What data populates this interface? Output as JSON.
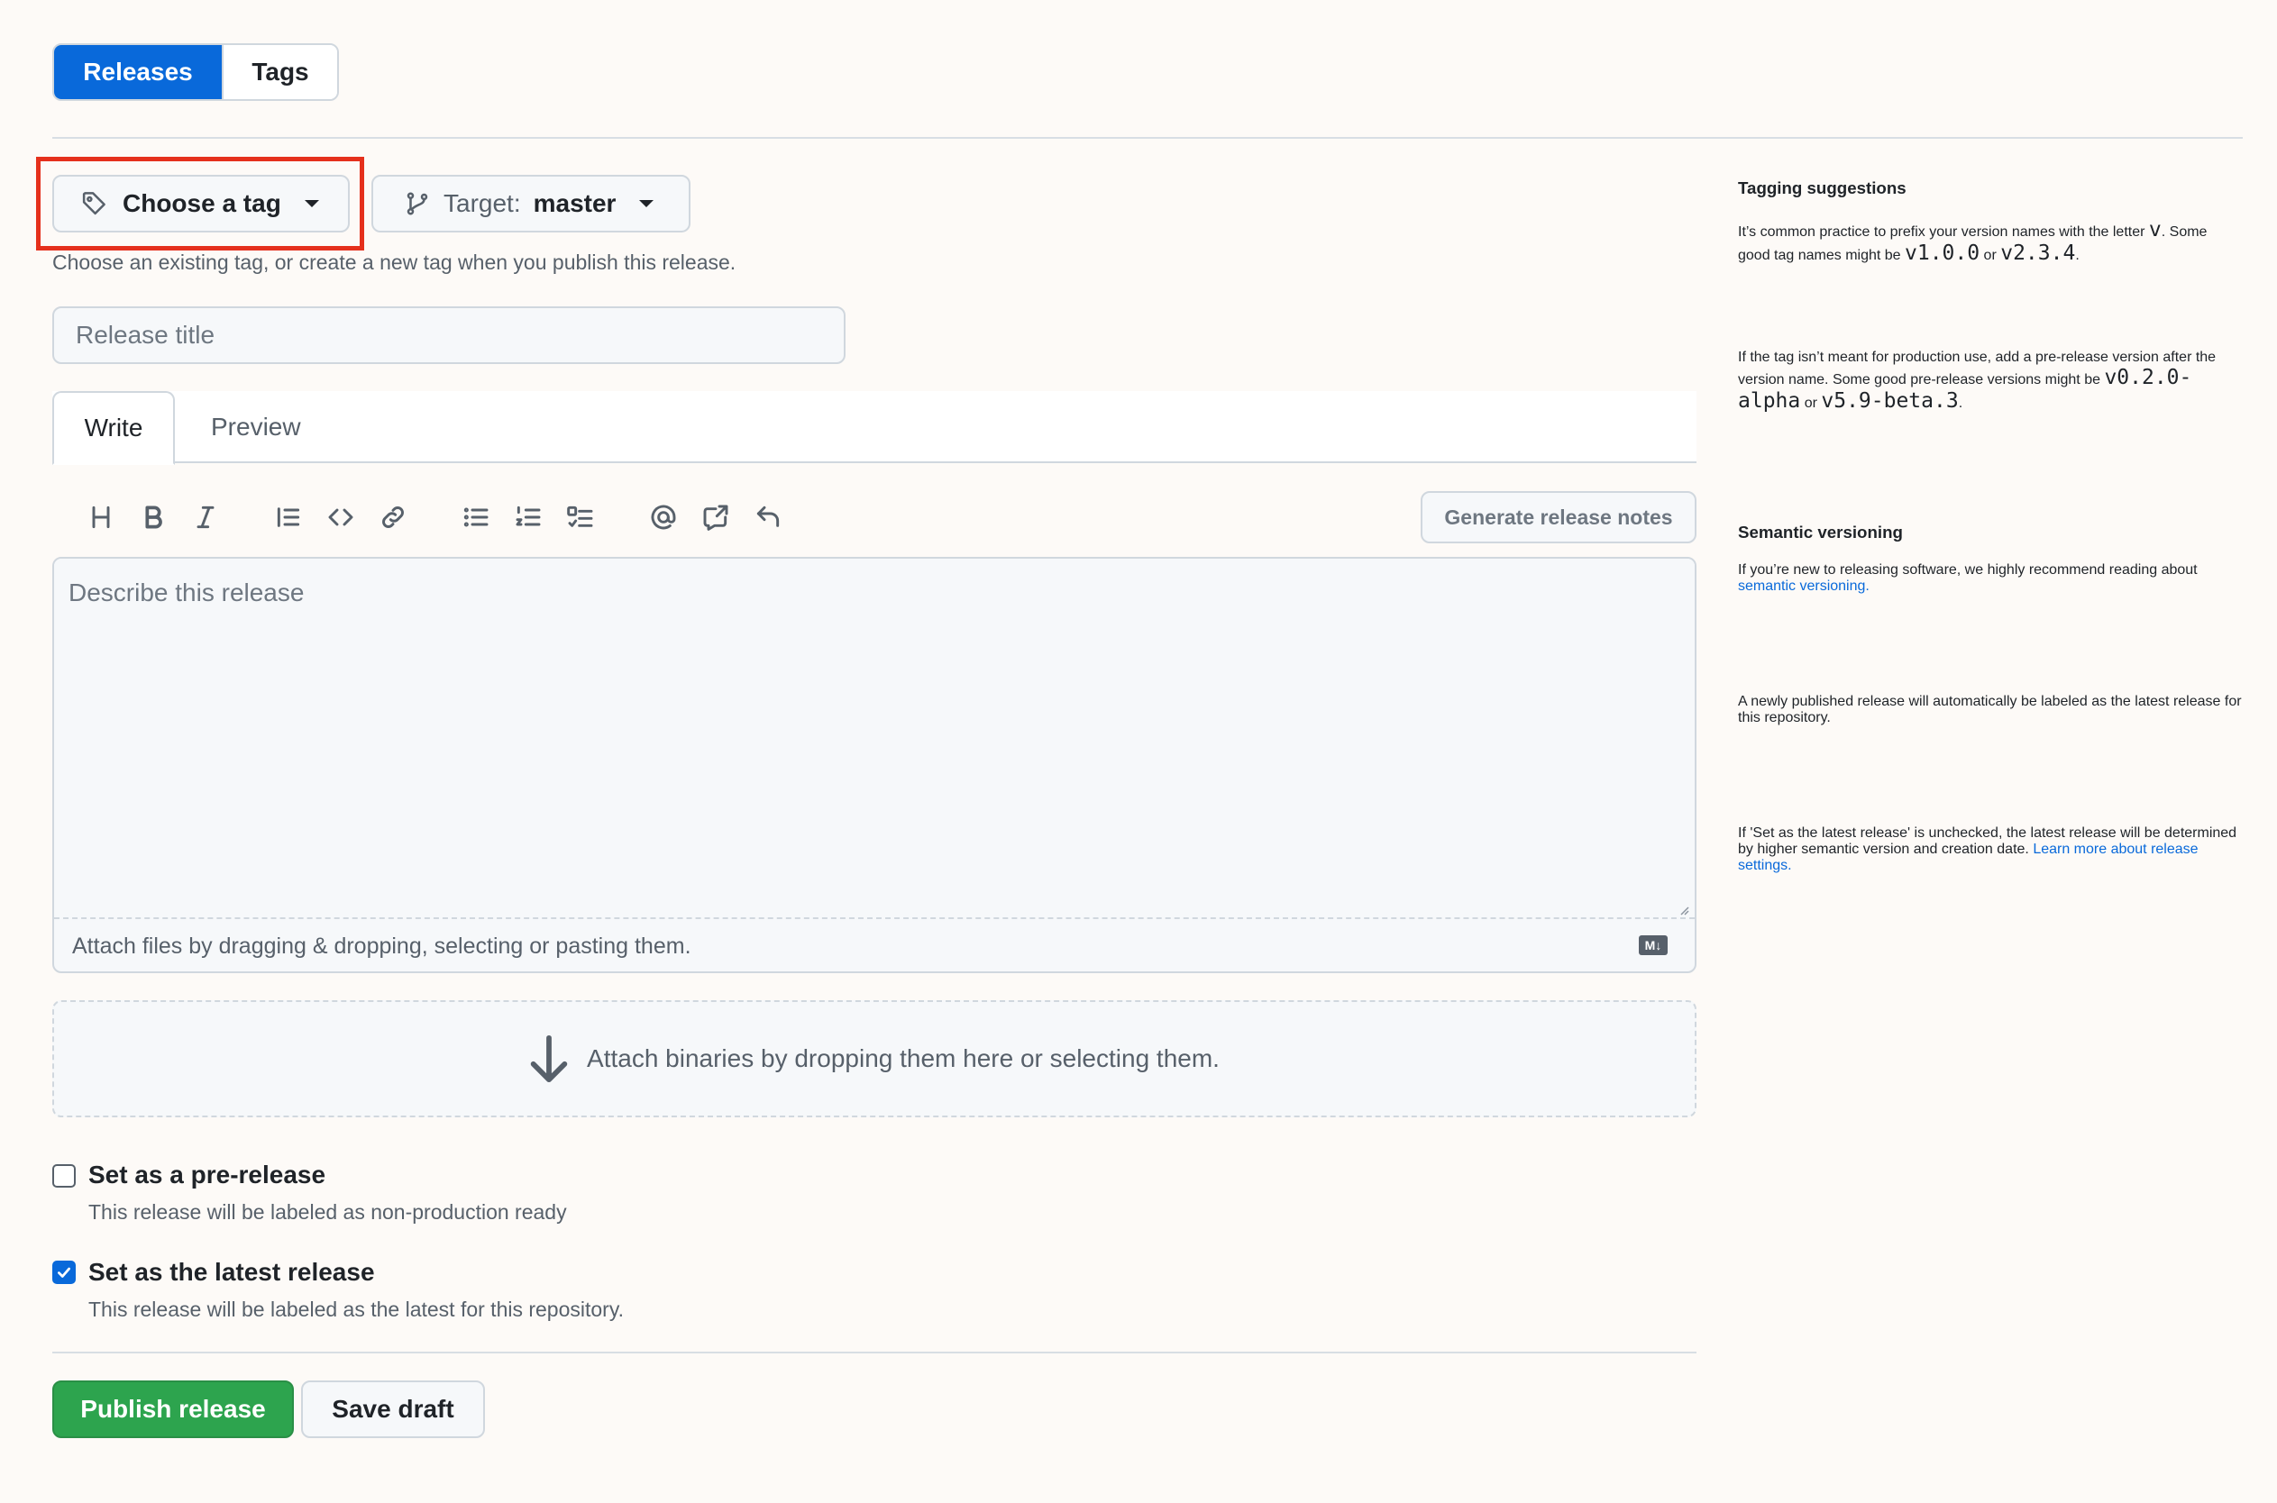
{
  "tabs": {
    "releases": "Releases",
    "tags": "Tags"
  },
  "tag_picker": {
    "label": "Choose a tag"
  },
  "target_picker": {
    "prefix": "Target:",
    "branch": "master"
  },
  "tag_hint": "Choose an existing tag, or create a new tag when you publish this release.",
  "release_title": {
    "placeholder": "Release title",
    "value": ""
  },
  "editor": {
    "tab_write": "Write",
    "tab_preview": "Preview",
    "generate_notes": "Generate release notes",
    "placeholder": "Describe this release",
    "attach_hint": "Attach files by dragging & dropping, selecting or pasting them.",
    "markdown_badge": "M↓",
    "toolbar": [
      "heading-icon",
      "bold-icon",
      "italic-icon",
      "quote-icon",
      "code-icon",
      "link-icon",
      "bulleted-list-icon",
      "numbered-list-icon",
      "task-list-icon",
      "mention-icon",
      "cross-reference-icon",
      "reply-icon"
    ]
  },
  "binaries_drop": "Attach binaries by dropping them here or selecting them.",
  "prerelease": {
    "label": "Set as a pre-release",
    "desc": "This release will be labeled as non-production ready",
    "checked": false
  },
  "latest": {
    "label": "Set as the latest release",
    "desc": "This release will be labeled as the latest for this repository.",
    "checked": true
  },
  "actions": {
    "publish": "Publish release",
    "draft": "Save draft"
  },
  "sidebar": {
    "tagging_title": "Tagging suggestions",
    "tagging_p1_a": "It’s common practice to prefix your version names with the letter ",
    "tagging_p1_code_v": "v",
    "tagging_p1_b": ". Some good tag names might be ",
    "tagging_p1_code1": "v1.0.0",
    "tagging_p1_or": " or ",
    "tagging_p1_code2": "v2.3.4",
    "tagging_p1_end": ".",
    "tagging_p2_a": "If the tag isn’t meant for production use, add a pre-release version after the version name. Some good pre-release versions might be ",
    "tagging_p2_code1": "v0.2.0-alpha",
    "tagging_p2_or": " or ",
    "tagging_p2_code2": "v5.9-beta.3",
    "tagging_p2_end": ".",
    "semver_title": "Semantic versioning",
    "semver_p1_a": "If you’re new to releasing software, we highly recommend reading about ",
    "semver_link": "semantic versioning.",
    "semver_p2": "A newly published release will automatically be labeled as the latest release for this repository.",
    "semver_p3": "If 'Set as the latest release' is unchecked, the latest release will be determined by higher semantic version and creation date.",
    "learn_more": "Learn more about release settings."
  }
}
